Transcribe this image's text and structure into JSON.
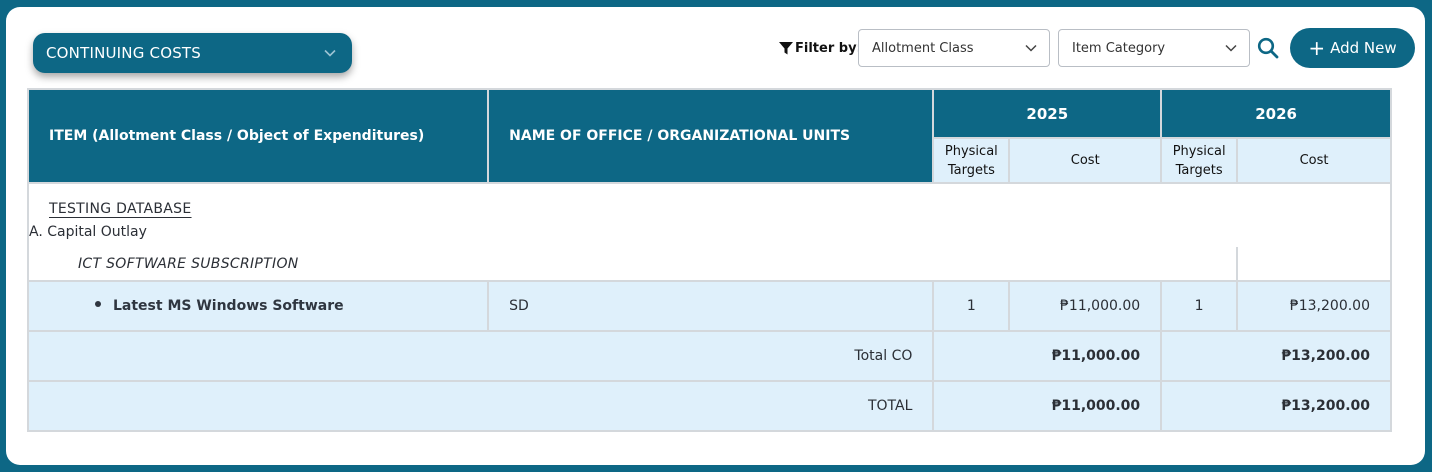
{
  "section": {
    "label": "CONTINUING COSTS"
  },
  "filters": {
    "label": "Filter by:",
    "allotment_class": "Allotment Class",
    "item_category": "Item Category"
  },
  "actions": {
    "add_label": "Add New"
  },
  "table": {
    "header": {
      "item": "ITEM (Allotment Class / Object of Expenditures)",
      "office": "NAME OF OFFICE / ORGANIZATIONAL UNITS",
      "years": [
        "2025",
        "2026"
      ],
      "physical_targets_line1": "Physical",
      "physical_targets_line2": "Targets",
      "cost": "Cost"
    },
    "database": "TESTING DATABASE",
    "allotment_class": "A. Capital Outlay",
    "category": "ICT SOFTWARE SUBSCRIPTION",
    "item": {
      "name": "Latest MS Windows Software",
      "office": "SD",
      "y2025_targets": "1",
      "y2025_cost": "₱11,000.00",
      "y2026_targets": "1",
      "y2026_cost": "₱13,200.00"
    },
    "subtotal": {
      "label": "Total CO",
      "y2025": "₱11,000.00",
      "y2026": "₱13,200.00"
    },
    "total": {
      "label": "TOTAL",
      "y2025": "₱11,000.00",
      "y2026": "₱13,200.00"
    }
  },
  "colors": {
    "primary": "#0d6785",
    "row_tint": "#dff0fb",
    "border": "#d4d8dc"
  }
}
